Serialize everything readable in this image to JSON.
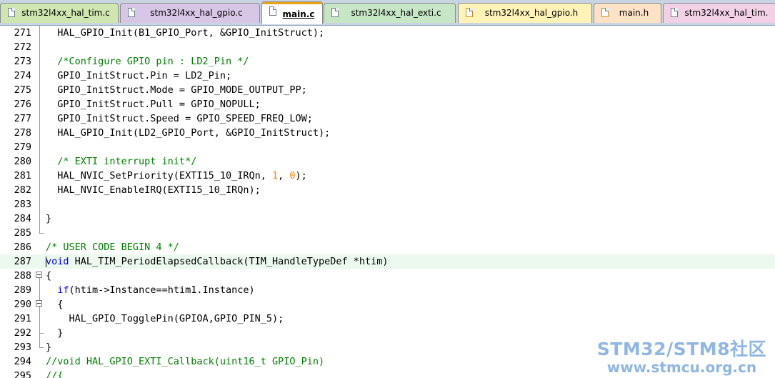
{
  "tabs": [
    {
      "label": "stm32l4xx_hal_tim.c",
      "kind": "source",
      "active": false,
      "bg": "#cfe6b0"
    },
    {
      "label": "stm32l4xx_hal_gpio.c",
      "kind": "source",
      "active": false,
      "bg": "#d7c6e6"
    },
    {
      "label": "main.c",
      "kind": "source",
      "active": true,
      "bg": "#ffffff"
    },
    {
      "label": "stm32l4xx_hal_exti.c",
      "kind": "source",
      "active": false,
      "bg": "#c7e6c6"
    },
    {
      "label": "stm32l4xx_hal_gpio.h",
      "kind": "header",
      "active": false,
      "bg": "#fff3b8"
    },
    {
      "label": "main.h",
      "kind": "header",
      "active": false,
      "bg": "#fde2c6"
    },
    {
      "label": "stm32l4xx_hal_tim.",
      "kind": "source",
      "active": false,
      "bg": "#f2d1e6"
    }
  ],
  "lines": [
    {
      "n": "271",
      "fold": "line",
      "tokens": [
        {
          "t": "  HAL_GPIO_Init(B1_GPIO_Port, &GPIO_InitStruct);",
          "c": ""
        }
      ]
    },
    {
      "n": "272",
      "fold": "line",
      "tokens": []
    },
    {
      "n": "273",
      "fold": "line",
      "tokens": [
        {
          "t": "  /*Configure GPIO pin : LD2_Pin */",
          "c": "cm"
        }
      ]
    },
    {
      "n": "274",
      "fold": "line",
      "tokens": [
        {
          "t": "  GPIO_InitStruct.Pin = LD2_Pin;",
          "c": ""
        }
      ]
    },
    {
      "n": "275",
      "fold": "line",
      "tokens": [
        {
          "t": "  GPIO_InitStruct.Mode = GPIO_MODE_OUTPUT_PP;",
          "c": ""
        }
      ]
    },
    {
      "n": "276",
      "fold": "line",
      "tokens": [
        {
          "t": "  GPIO_InitStruct.Pull = GPIO_NOPULL;",
          "c": ""
        }
      ]
    },
    {
      "n": "277",
      "fold": "line",
      "tokens": [
        {
          "t": "  GPIO_InitStruct.Speed = GPIO_SPEED_FREQ_LOW;",
          "c": ""
        }
      ]
    },
    {
      "n": "278",
      "fold": "line",
      "tokens": [
        {
          "t": "  HAL_GPIO_Init(LD2_GPIO_Port, &GPIO_InitStruct);",
          "c": ""
        }
      ]
    },
    {
      "n": "279",
      "fold": "line",
      "tokens": []
    },
    {
      "n": "280",
      "fold": "line",
      "tokens": [
        {
          "t": "  /* EXTI interrupt init*/",
          "c": "cm"
        }
      ]
    },
    {
      "n": "281",
      "fold": "line",
      "tokens": [
        {
          "t": "  HAL_NVIC_SetPriority(EXTI15_10_IRQn, ",
          "c": ""
        },
        {
          "t": "1",
          "c": "num"
        },
        {
          "t": ", ",
          "c": ""
        },
        {
          "t": "0",
          "c": "num"
        },
        {
          "t": ");",
          "c": ""
        }
      ]
    },
    {
      "n": "282",
      "fold": "line",
      "tokens": [
        {
          "t": "  HAL_NVIC_EnableIRQ(EXTI15_10_IRQn);",
          "c": ""
        }
      ]
    },
    {
      "n": "283",
      "fold": "line",
      "tokens": []
    },
    {
      "n": "284",
      "fold": "line",
      "tokens": [
        {
          "t": "}",
          "c": ""
        }
      ]
    },
    {
      "n": "285",
      "fold": "end",
      "tokens": []
    },
    {
      "n": "286",
      "fold": "none",
      "tokens": [
        {
          "t": "/* USER CODE BEGIN 4 */",
          "c": "cm"
        }
      ]
    },
    {
      "n": "287",
      "fold": "none",
      "highlight": true,
      "caret": true,
      "tokens": [
        {
          "t": "void",
          "c": "kw"
        },
        {
          "t": " HAL_TIM_PeriodElapsedCallback(TIM_HandleTypeDef *htim)",
          "c": ""
        }
      ]
    },
    {
      "n": "288",
      "fold": "box",
      "tokens": [
        {
          "t": "{",
          "c": ""
        }
      ]
    },
    {
      "n": "289",
      "fold": "line",
      "tokens": [
        {
          "t": "  ",
          "c": ""
        },
        {
          "t": "if",
          "c": "kw"
        },
        {
          "t": "(htim->Instance==htim1.Instance)",
          "c": ""
        }
      ]
    },
    {
      "n": "290",
      "fold": "box",
      "tokens": [
        {
          "t": "  {",
          "c": ""
        }
      ]
    },
    {
      "n": "291",
      "fold": "line",
      "tokens": [
        {
          "t": "    HAL_GPIO_TogglePin(GPIOA,GPIO_PIN_5);",
          "c": ""
        }
      ]
    },
    {
      "n": "292",
      "fold": "subend",
      "tokens": [
        {
          "t": "  }",
          "c": ""
        }
      ]
    },
    {
      "n": "293",
      "fold": "end",
      "tokens": [
        {
          "t": "}",
          "c": ""
        }
      ]
    },
    {
      "n": "294",
      "fold": "none",
      "tokens": [
        {
          "t": "//void HAL_GPIO_EXTI_Callback(uint16_t GPIO_Pin)",
          "c": "cm"
        }
      ]
    },
    {
      "n": "295",
      "fold": "none",
      "tokens": [
        {
          "t": "//{",
          "c": "cm"
        }
      ]
    }
  ],
  "watermark": {
    "line1": "STM32/STM8社区",
    "line2": "www.stmcu.org.cn"
  }
}
